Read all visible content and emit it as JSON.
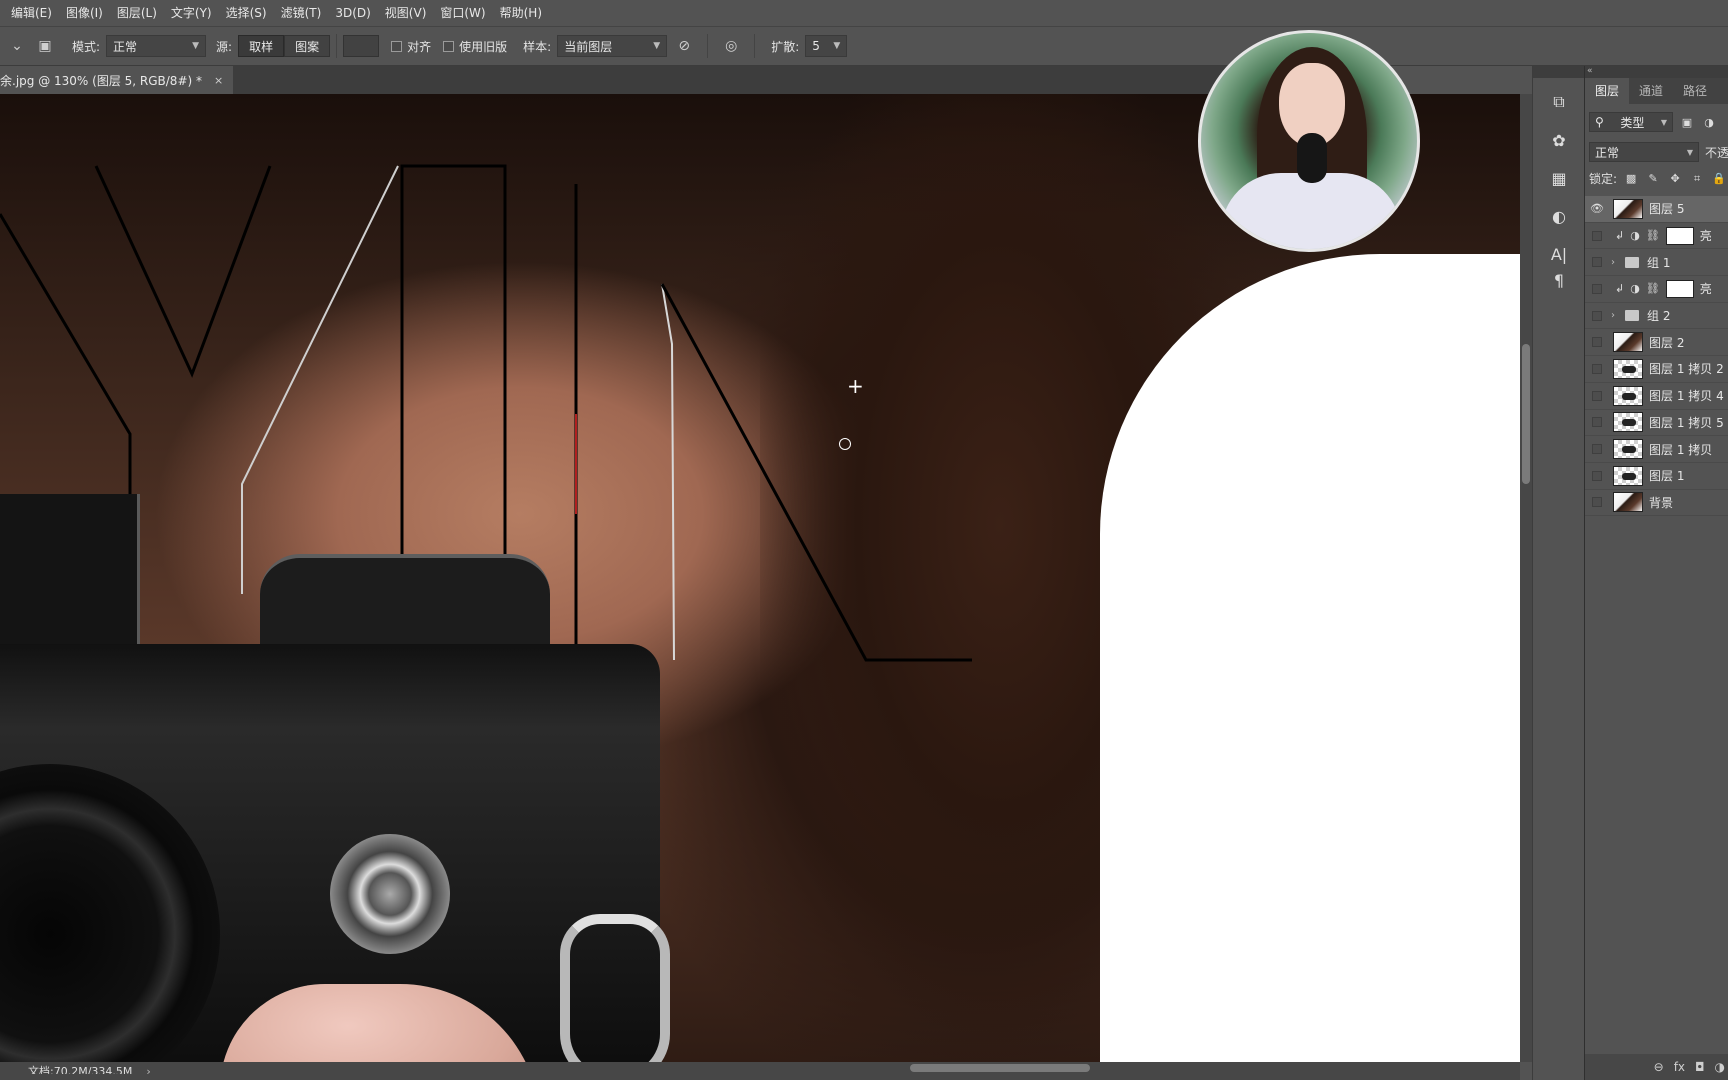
{
  "menubar": {
    "items": [
      "编辑(E)",
      "图像(I)",
      "图层(L)",
      "文字(Y)",
      "选择(S)",
      "滤镜(T)",
      "3D(D)",
      "视图(V)",
      "窗口(W)",
      "帮助(H)"
    ]
  },
  "options": {
    "mode_label": "模式:",
    "mode_value": "正常",
    "source_label": "源:",
    "source_sample_button": "取样",
    "source_pattern_button": "图案",
    "align_label": "对齐",
    "legacy_label": "使用旧版",
    "sample_label": "样本:",
    "sample_value": "当前图层",
    "diffusion_label": "扩散:",
    "diffusion_value": "5"
  },
  "document": {
    "tab_title": "余.jpg @ 130% (图层 5, RGB/8#) *",
    "close_glyph": "×",
    "status_text": "文档:70.2M/334.5M",
    "status_arrow": "›"
  },
  "panel": {
    "tabs": [
      "图层",
      "通道",
      "路径"
    ],
    "active_tab": "图层",
    "filter_value": "类型",
    "blend_mode": "正常",
    "opacity_label": "不透",
    "lock_label": "锁定:"
  },
  "layers": [
    {
      "name": "图层 5",
      "kind": "photo",
      "visible": true,
      "selected": true
    },
    {
      "name": "亮",
      "kind": "adjustment",
      "visible": false
    },
    {
      "name": "组 1",
      "kind": "group",
      "visible": false
    },
    {
      "name": "亮",
      "kind": "adjustment",
      "visible": false
    },
    {
      "name": "组 2",
      "kind": "group",
      "visible": false
    },
    {
      "name": "图层 2",
      "kind": "photo",
      "visible": false
    },
    {
      "name": "图层 1 拷贝 2",
      "kind": "partial",
      "visible": false
    },
    {
      "name": "图层 1 拷贝 4",
      "kind": "partial",
      "visible": false
    },
    {
      "name": "图层 1 拷贝 5",
      "kind": "partial",
      "visible": false
    },
    {
      "name": "图层 1 拷贝",
      "kind": "partial",
      "visible": false
    },
    {
      "name": "图层 1",
      "kind": "partial",
      "visible": false
    },
    {
      "name": "背景",
      "kind": "photo",
      "visible": false
    }
  ],
  "icons": {
    "eye": "👁",
    "stamp": "⛃",
    "pressure": "◎",
    "brush": "✎",
    "panel_bottom": [
      "⊖",
      "fx",
      "◘",
      "◑"
    ],
    "toolstrip": [
      "history-icon",
      "brush-preset-icon",
      "grid-icon",
      "adjust-icon",
      "type-icon",
      "paragraph-icon"
    ]
  }
}
